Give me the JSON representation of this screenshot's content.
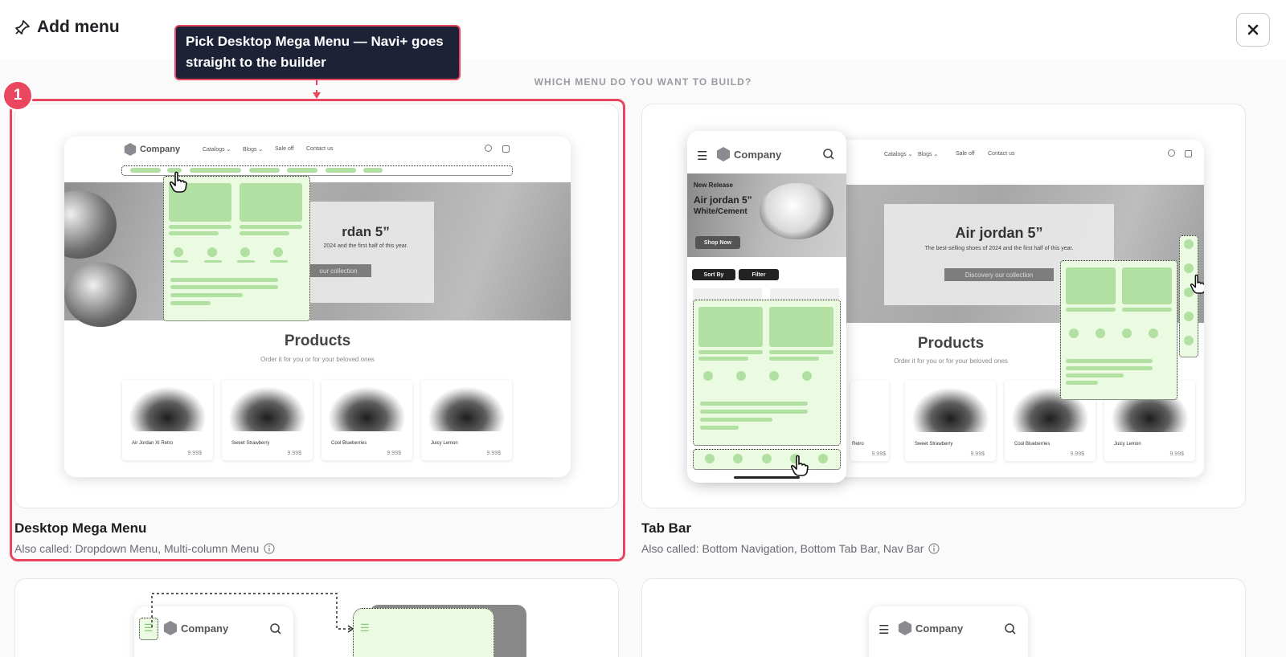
{
  "header": {
    "title": "Add menu",
    "close_icon": "close-icon",
    "title_icon": "pin-icon"
  },
  "prompt": "WHICH MENU DO YOU WANT TO BUILD?",
  "tooltip": {
    "text": "Pick Desktop Mega Menu — Navi+ goes straight to the builder",
    "step": "1"
  },
  "options": [
    {
      "title": "Desktop Mega Menu",
      "subtitle": "Also called: Dropdown Menu, Multi-column Menu",
      "selected": true
    },
    {
      "title": "Tab Bar",
      "subtitle": "Also called: Bottom Navigation, Bottom Tab Bar, Nav Bar",
      "selected": false
    }
  ],
  "mock_site": {
    "brand": "Company",
    "nav": [
      "Catalogs ⌄",
      "Blogs ⌄",
      "Sale off",
      "Contact us"
    ],
    "hero_title_cropped": "rdan 5”",
    "hero_sub_cropped": "2024 and the first half of this year.",
    "hero_btn_cropped": "our collection",
    "hero_title": "Air jordan 5”",
    "hero_sub": "The best-selling shoes of 2024 and the first half of this year.",
    "hero_btn": "Discovery our collection",
    "products_title": "Products",
    "products_sub": "Order it for you or for your beloved ones",
    "products": [
      {
        "name": "Air Jordan XI Retro",
        "price": "9.99$"
      },
      {
        "name": "Sweet Strawberry",
        "price": "9.99$"
      },
      {
        "name": "Cool Blueberries",
        "price": "9.99$"
      },
      {
        "name": "Juicy Lemon",
        "price": "9.99$"
      }
    ],
    "products_tab_cropped": [
      "Retro",
      "9.99$"
    ],
    "mobile": {
      "badge": "New Release",
      "title1": "Air jordan 5”",
      "title2": "White/Cement",
      "cta": "Shop Now",
      "sort": "Sort By",
      "filter": "Filter"
    }
  },
  "colors": {
    "accent": "#e8475f",
    "tooltip_bg": "#1d2236",
    "menu_green": "#b2e0a2",
    "menu_panel": "#eafbe2"
  }
}
